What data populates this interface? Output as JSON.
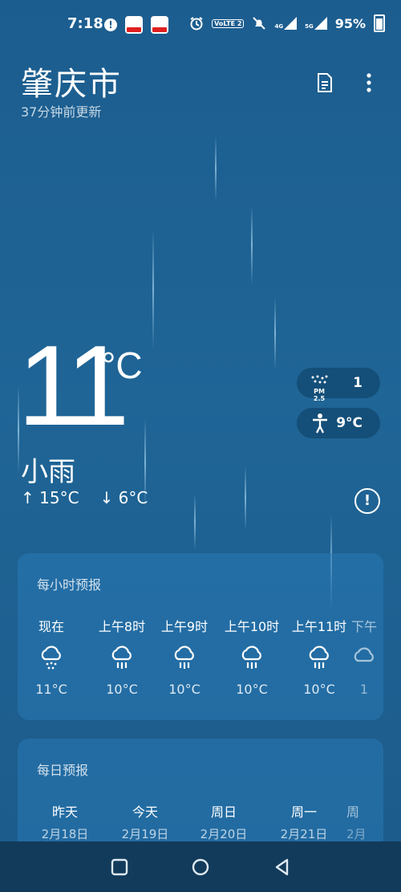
{
  "status_bar": {
    "time": "7:18",
    "network_a": "4G",
    "network_b": "5G",
    "volte": "VoLTE 2",
    "battery": "95%"
  },
  "header": {
    "city": "肇庆市",
    "updated": "37分钟前更新"
  },
  "current": {
    "temp": "11",
    "unit": "°C",
    "condition": "小雨",
    "high": "↑ 15°C",
    "low": "↓ 6°C",
    "pm25_label": "PM 2.5",
    "pm25": "1",
    "feels_like": "9°C"
  },
  "hourly": {
    "title": "每小时预报",
    "items": [
      {
        "label": "现在",
        "icon": "rain-heavy-icon",
        "temp": "11°C"
      },
      {
        "label": "上午8时",
        "icon": "rain-icon",
        "temp": "10°C"
      },
      {
        "label": "上午9时",
        "icon": "rain-icon",
        "temp": "10°C"
      },
      {
        "label": "上午10时",
        "icon": "rain-icon",
        "temp": "10°C"
      },
      {
        "label": "上午11时",
        "icon": "rain-icon",
        "temp": "10°C"
      },
      {
        "label": "下午",
        "icon": "cloud-icon",
        "temp": "1"
      }
    ]
  },
  "daily": {
    "title": "每日预报",
    "items": [
      {
        "day": "昨天",
        "date": "2月18日"
      },
      {
        "day": "今天",
        "date": "2月19日"
      },
      {
        "day": "周日",
        "date": "2月20日"
      },
      {
        "day": "周一",
        "date": "2月21日"
      },
      {
        "day": "周",
        "date": "2月"
      }
    ]
  }
}
